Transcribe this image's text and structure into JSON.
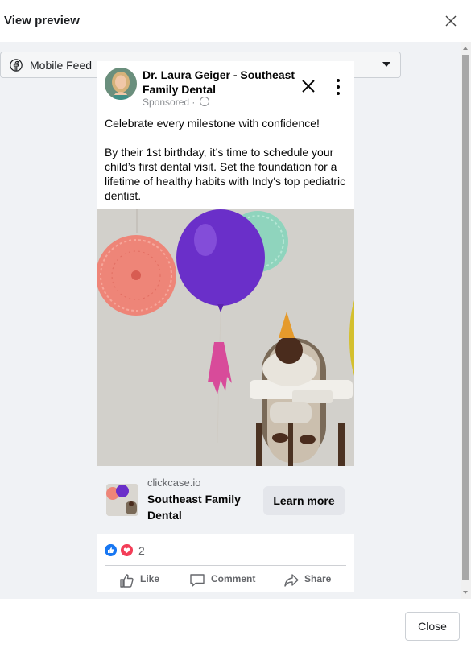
{
  "modal": {
    "title": "View preview",
    "close_label": "Close"
  },
  "placement": {
    "selected": "Mobile Feed"
  },
  "ad": {
    "page_name": "Dr. Laura Geiger - Southeast Family Dental",
    "sponsored": "Sponsored · ",
    "caption_line1": "Celebrate every milestone with confidence!",
    "caption_line2": "By their 1st birthday, it’s time to schedule your child’s first dental visit. Set the foundation for a lifetime of healthy habits with Indy's top pediatric dentist.",
    "link": {
      "domain": "clickcase.io",
      "title": "Southeast Family Dental",
      "cta": "Learn more"
    },
    "reactions": {
      "count": "2"
    },
    "actions": {
      "like": "Like",
      "comment": "Comment",
      "share": "Share"
    }
  },
  "colors": {
    "facebook_blue": "#1877f2",
    "love_red": "#f33e58",
    "balloon_purple": "#6a2fc9"
  }
}
